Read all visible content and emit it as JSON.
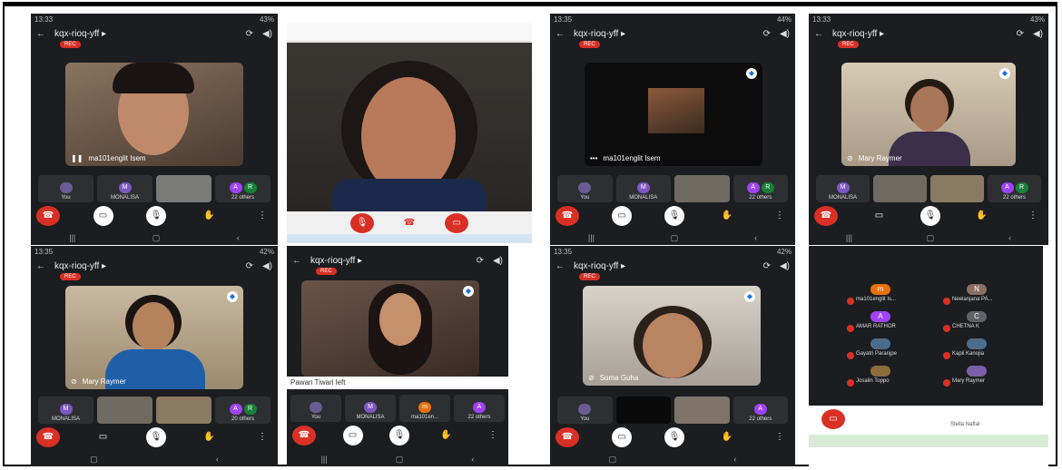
{
  "meeting": {
    "code": "kqx-rioq-yff ▸",
    "rec": "REC",
    "status_time_1": "13:33",
    "status_time_2": "13:35",
    "battery": "43%",
    "battery_2": "44%",
    "battery_3": "42%"
  },
  "panels": {
    "p1": {
      "speaker": "ma101englit Isem",
      "thumb_you": "You",
      "thumb_mona": "MONALISA",
      "thumb_others": "22 others"
    },
    "p3": {
      "speaker": "ma101englit Isem",
      "thumb_you": "You",
      "thumb_mona": "MONALISA",
      "thumb_others": "22 others"
    },
    "p4": {
      "speaker": "Mary Raymer",
      "thumb_mona": "MONALISA",
      "thumb_others": "22 others"
    },
    "p5": {
      "speaker": "Mary Raymer",
      "thumb_mona": "MONALISA",
      "thumb_others": "20 others"
    },
    "p6": {
      "notice": "Pawan Tiwari left",
      "thumb_you": "You",
      "thumb_mona": "MONALISA",
      "thumb_ma": "ma101en...",
      "thumb_others": "22 others"
    },
    "p7": {
      "speaker": "Soma Guha",
      "thumb_you": "You",
      "thumb_others": "22 others"
    },
    "p8": {
      "participants": [
        {
          "initial": "m",
          "name": "ma101englit Is...",
          "color": "#e8710a"
        },
        {
          "initial": "N",
          "name": "Neelanjana PA...",
          "color": "#8d6e63"
        },
        {
          "initial": "A",
          "name": "AMAR RATHOR",
          "color": "#a142f4"
        },
        {
          "initial": "C",
          "name": "CHETNA K",
          "color": "#5f6368"
        },
        {
          "initial": "",
          "name": "Gayatri Paranjpe",
          "color": "#4a6d8c"
        },
        {
          "initial": "",
          "name": "Kapil Kanojia",
          "color": "#4a6d8c"
        },
        {
          "initial": "",
          "name": "Josalin Toppo",
          "color": "#8b6d3b"
        },
        {
          "initial": "",
          "name": "Mary Raymer",
          "color": "#7b5ea7"
        }
      ],
      "label": "Stella Naftal"
    }
  },
  "avatars": {
    "M": "M",
    "A": "A",
    "R": "R",
    "m": "m"
  }
}
